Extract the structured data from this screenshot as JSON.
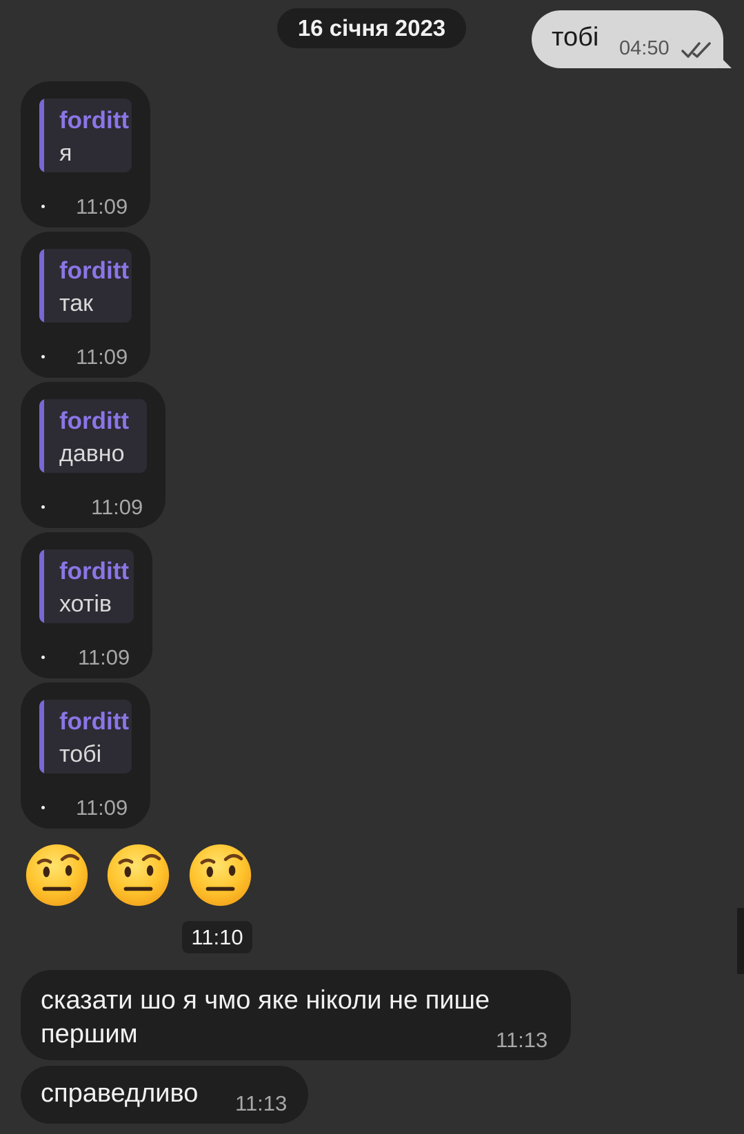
{
  "conversation": {
    "date_separator": "16 січня 2023",
    "outgoing": {
      "text": "тобі",
      "time": "04:50",
      "status_icon": "double-check-icon"
    },
    "replies": [
      {
        "name": "forditt",
        "quote": "я",
        "time": "11:09"
      },
      {
        "name": "forditt",
        "quote": "так",
        "time": "11:09"
      },
      {
        "name": "forditt",
        "quote": "давно",
        "time": "11:09"
      },
      {
        "name": "forditt",
        "quote": "хотів",
        "time": "11:09"
      },
      {
        "name": "forditt",
        "quote": "тобі",
        "time": "11:09"
      }
    ],
    "emoji": {
      "icons": [
        "raised-eyebrow-face-icon",
        "raised-eyebrow-face-icon",
        "raised-eyebrow-face-icon"
      ],
      "time": "11:10"
    },
    "messages": [
      {
        "lines": [
          "сказати шо я чмо яке ніколи не пише",
          "першим"
        ],
        "time": "11:13"
      },
      {
        "lines": [
          "справедливо"
        ],
        "time": "11:13"
      }
    ]
  }
}
